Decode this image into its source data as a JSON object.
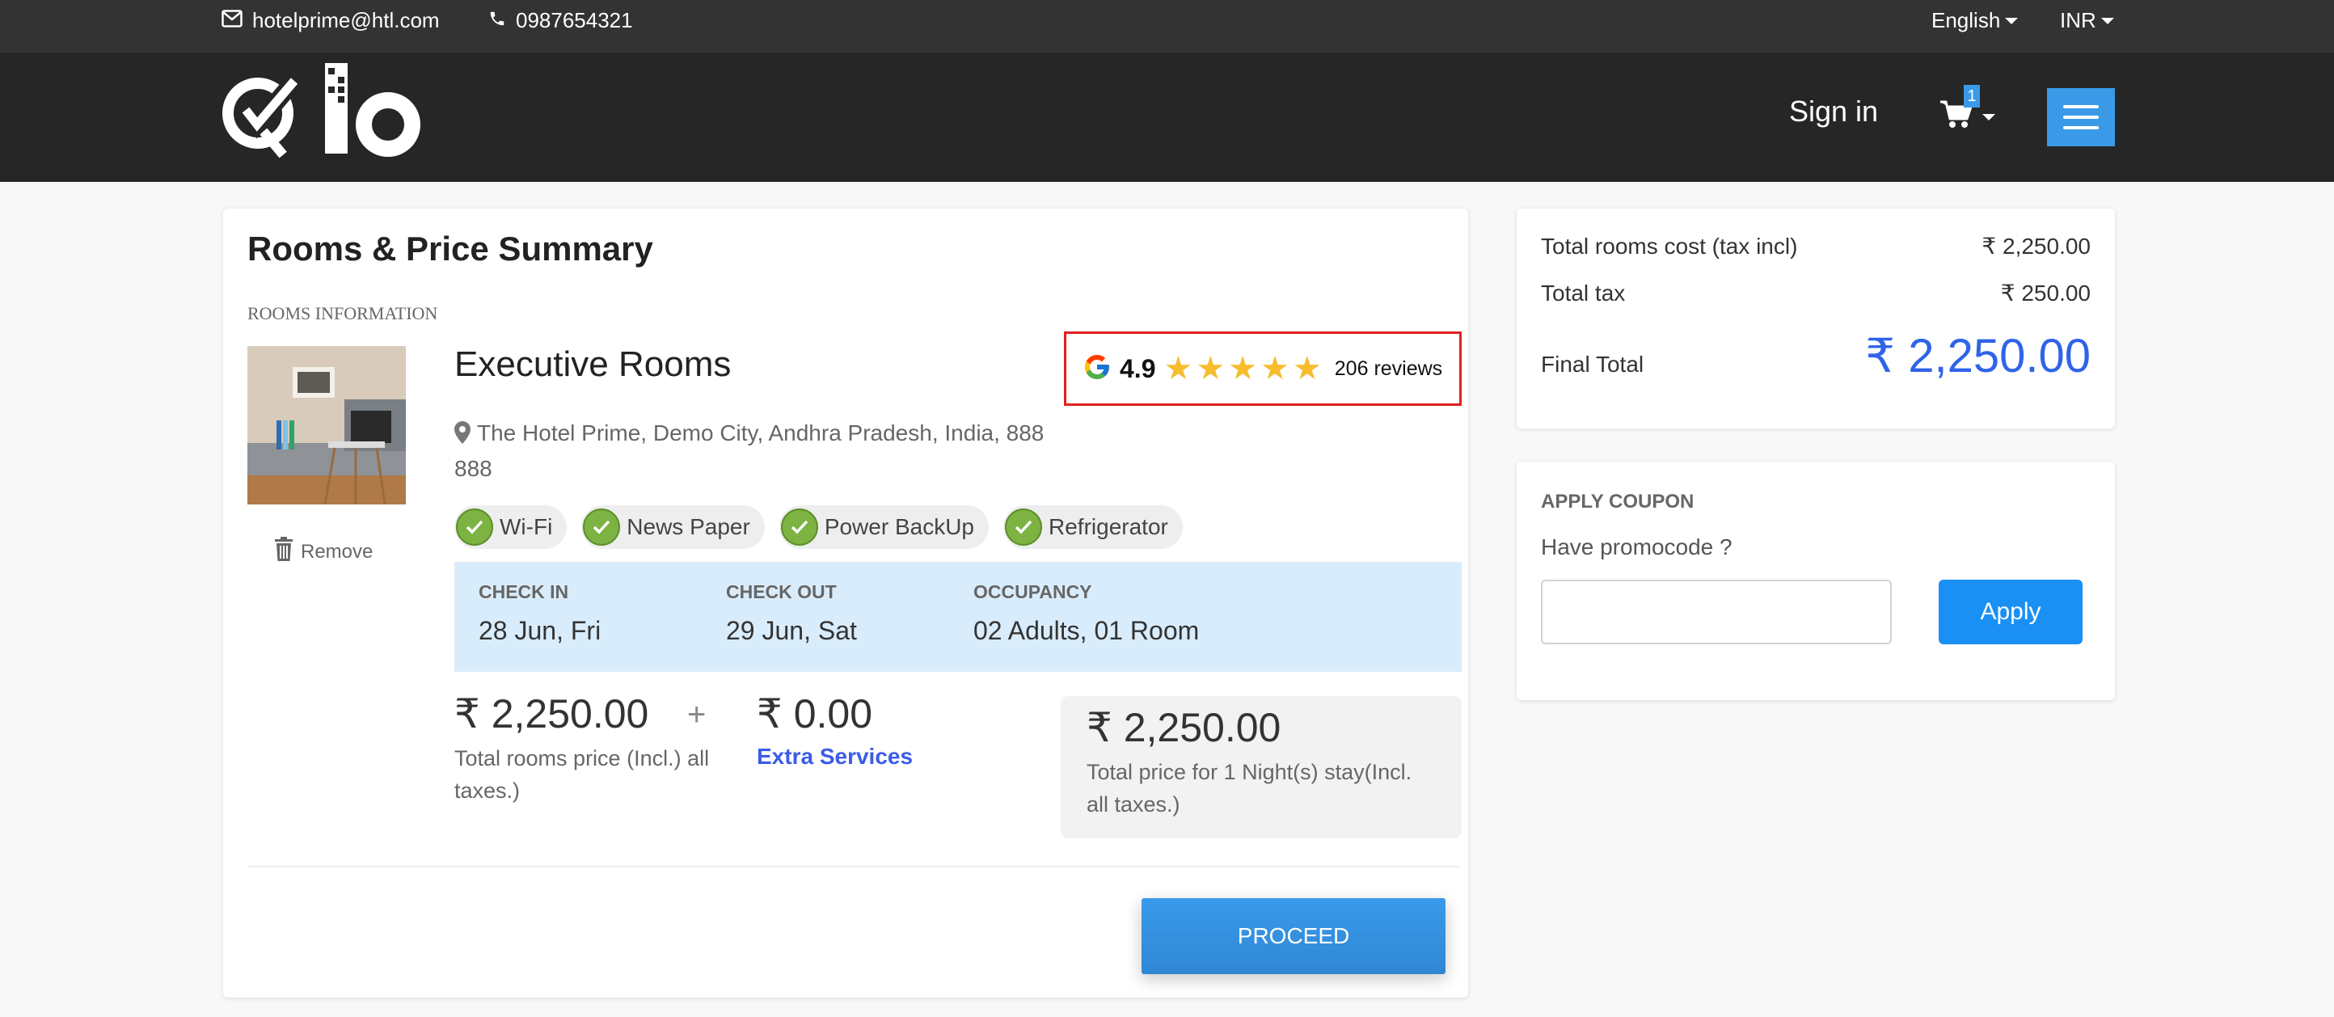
{
  "topbar": {
    "email": "hotelprime@htl.com",
    "phone": "0987654321",
    "language": "English",
    "currency": "INR"
  },
  "header": {
    "brand": "Qlo",
    "signin_label": "Sign in",
    "cart_count": "1",
    "accent_color": "#3a9ae8"
  },
  "main": {
    "title": "Rooms & Price Summary",
    "section_label": "ROOMS INFORMATION",
    "room": {
      "name": "Executive Rooms",
      "address": "The Hotel Prime, Demo City, Andhra Pradesh, India, 888 888",
      "remove_label": "Remove",
      "rating": {
        "score": "4.9",
        "stars": 5,
        "reviews": "206 reviews"
      },
      "amenities": [
        "Wi-Fi",
        "News Paper",
        "Power BackUp",
        "Refrigerator"
      ],
      "stay": {
        "check_in_label": "CHECK IN",
        "check_in": "28 Jun, Fri",
        "check_out_label": "CHECK OUT",
        "check_out": "29 Jun, Sat",
        "occupancy_label": "OCCUPANCY",
        "occupancy": "02 Adults, 01 Room"
      },
      "rooms_price": "₹ 2,250.00",
      "rooms_price_label": "Total rooms price (Incl.) all taxes.)",
      "plus": "+",
      "extra_price": "₹ 0.00",
      "extra_label": "Extra Services",
      "total_price": "₹ 2,250.00",
      "total_label": "Total price for 1 Night(s) stay(Incl. all taxes.)"
    },
    "proceed_label": "PROCEED"
  },
  "summary": {
    "rows": [
      {
        "label": "Total rooms cost (tax incl)",
        "value": "₹ 2,250.00"
      },
      {
        "label": "Total tax",
        "value": "₹ 250.00"
      }
    ],
    "final_label": "Final Total",
    "final_value": "₹ 2,250.00",
    "final_color": "#2f64e8"
  },
  "coupon": {
    "title": "APPLY COUPON",
    "question": "Have promocode ?",
    "input_value": "",
    "input_placeholder": "",
    "apply_label": "Apply"
  }
}
